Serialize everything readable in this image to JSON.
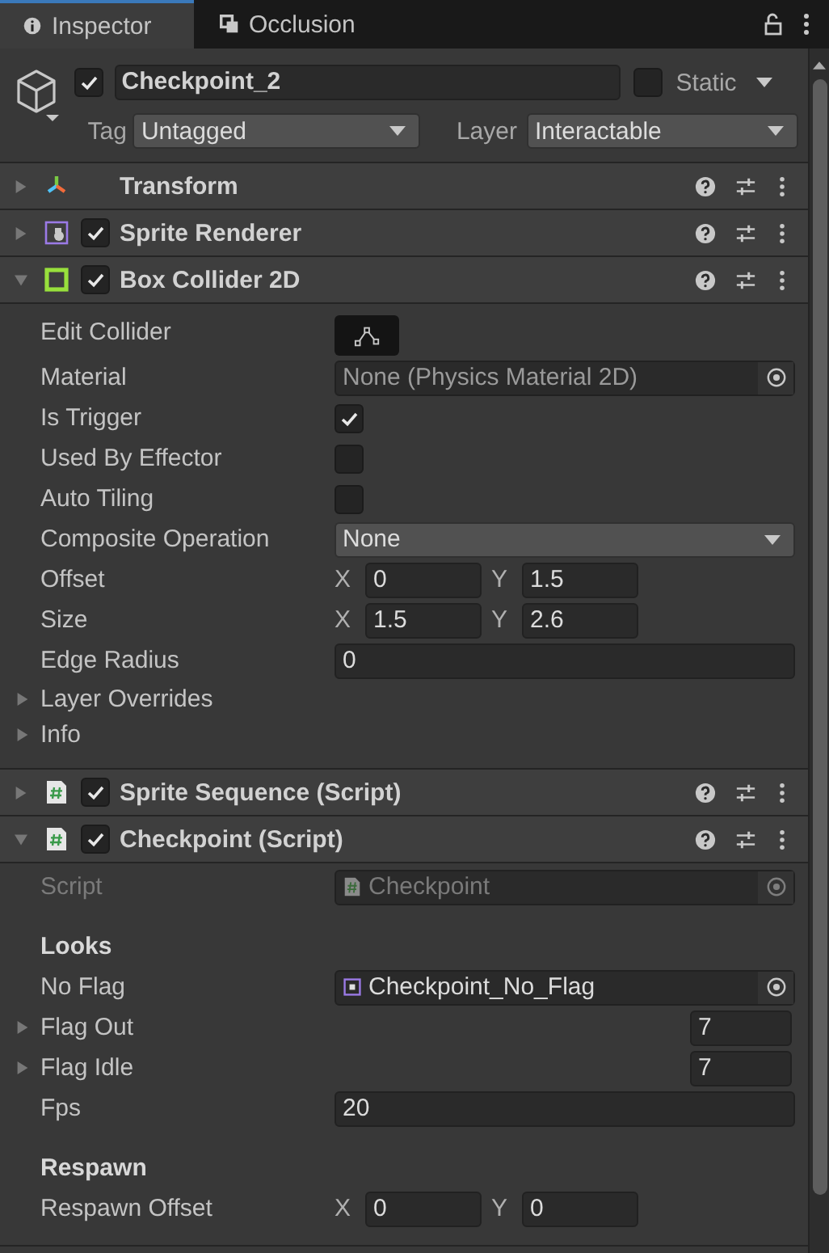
{
  "tabs": [
    {
      "label": "Inspector",
      "selected": true
    },
    {
      "label": "Occlusion",
      "selected": false
    }
  ],
  "object": {
    "enabled": true,
    "name": "Checkpoint_2",
    "static_label": "Static",
    "static": false,
    "tag_label": "Tag",
    "tag": "Untagged",
    "layer_label": "Layer",
    "layer": "Interactable"
  },
  "components": [
    {
      "kind": "transform",
      "name": "Transform",
      "expanded": false
    },
    {
      "kind": "sprite",
      "name": "Sprite Renderer",
      "enabled": true,
      "expanded": false
    },
    {
      "kind": "collider",
      "name": "Box Collider 2D",
      "enabled": true,
      "expanded": true,
      "properties": [
        {
          "kind": "button",
          "label": "Edit Collider"
        },
        {
          "kind": "objectref",
          "label": "Material",
          "value": "None (Physics Material 2D)"
        },
        {
          "kind": "checkbox",
          "label": "Is Trigger",
          "checked": true
        },
        {
          "kind": "checkbox",
          "label": "Used By Effector",
          "checked": false
        },
        {
          "kind": "checkbox",
          "label": "Auto Tiling",
          "checked": false
        },
        {
          "kind": "dropdown",
          "label": "Composite Operation",
          "value": "None"
        },
        {
          "kind": "vector2",
          "label": "Offset",
          "fields": [
            {
              "axis": "X",
              "value": "0"
            },
            {
              "axis": "Y",
              "value": "1.5"
            }
          ]
        },
        {
          "kind": "vector2",
          "label": "Size",
          "fields": [
            {
              "axis": "X",
              "value": "1.5"
            },
            {
              "axis": "Y",
              "value": "2.6"
            }
          ]
        },
        {
          "kind": "field",
          "label": "Edge Radius",
          "value": "0"
        },
        {
          "kind": "foldout",
          "label": "Layer Overrides",
          "expanded": false
        },
        {
          "kind": "foldout",
          "label": "Info",
          "expanded": false
        }
      ]
    },
    {
      "kind": "script",
      "name": "Sprite Sequence (Script)",
      "enabled": true,
      "expanded": false
    },
    {
      "kind": "script",
      "name": "Checkpoint (Script)",
      "enabled": true,
      "expanded": true,
      "properties": [
        {
          "kind": "scriptref",
          "label": "Script",
          "value": "Checkpoint",
          "disabled": true
        },
        {
          "kind": "header",
          "label": "Looks"
        },
        {
          "kind": "spriteref",
          "label": "No Flag",
          "value": "Checkpoint_No_Flag"
        },
        {
          "kind": "array",
          "label": "Flag Out",
          "value": "7",
          "expanded": false
        },
        {
          "kind": "array",
          "label": "Flag Idle",
          "value": "7",
          "expanded": false
        },
        {
          "kind": "field",
          "label": "Fps",
          "value": "20"
        },
        {
          "kind": "header",
          "label": "Respawn"
        },
        {
          "kind": "vector2",
          "label": "Respawn Offset",
          "fields": [
            {
              "axis": "X",
              "value": "0"
            },
            {
              "axis": "Y",
              "value": "0"
            }
          ]
        }
      ]
    }
  ]
}
